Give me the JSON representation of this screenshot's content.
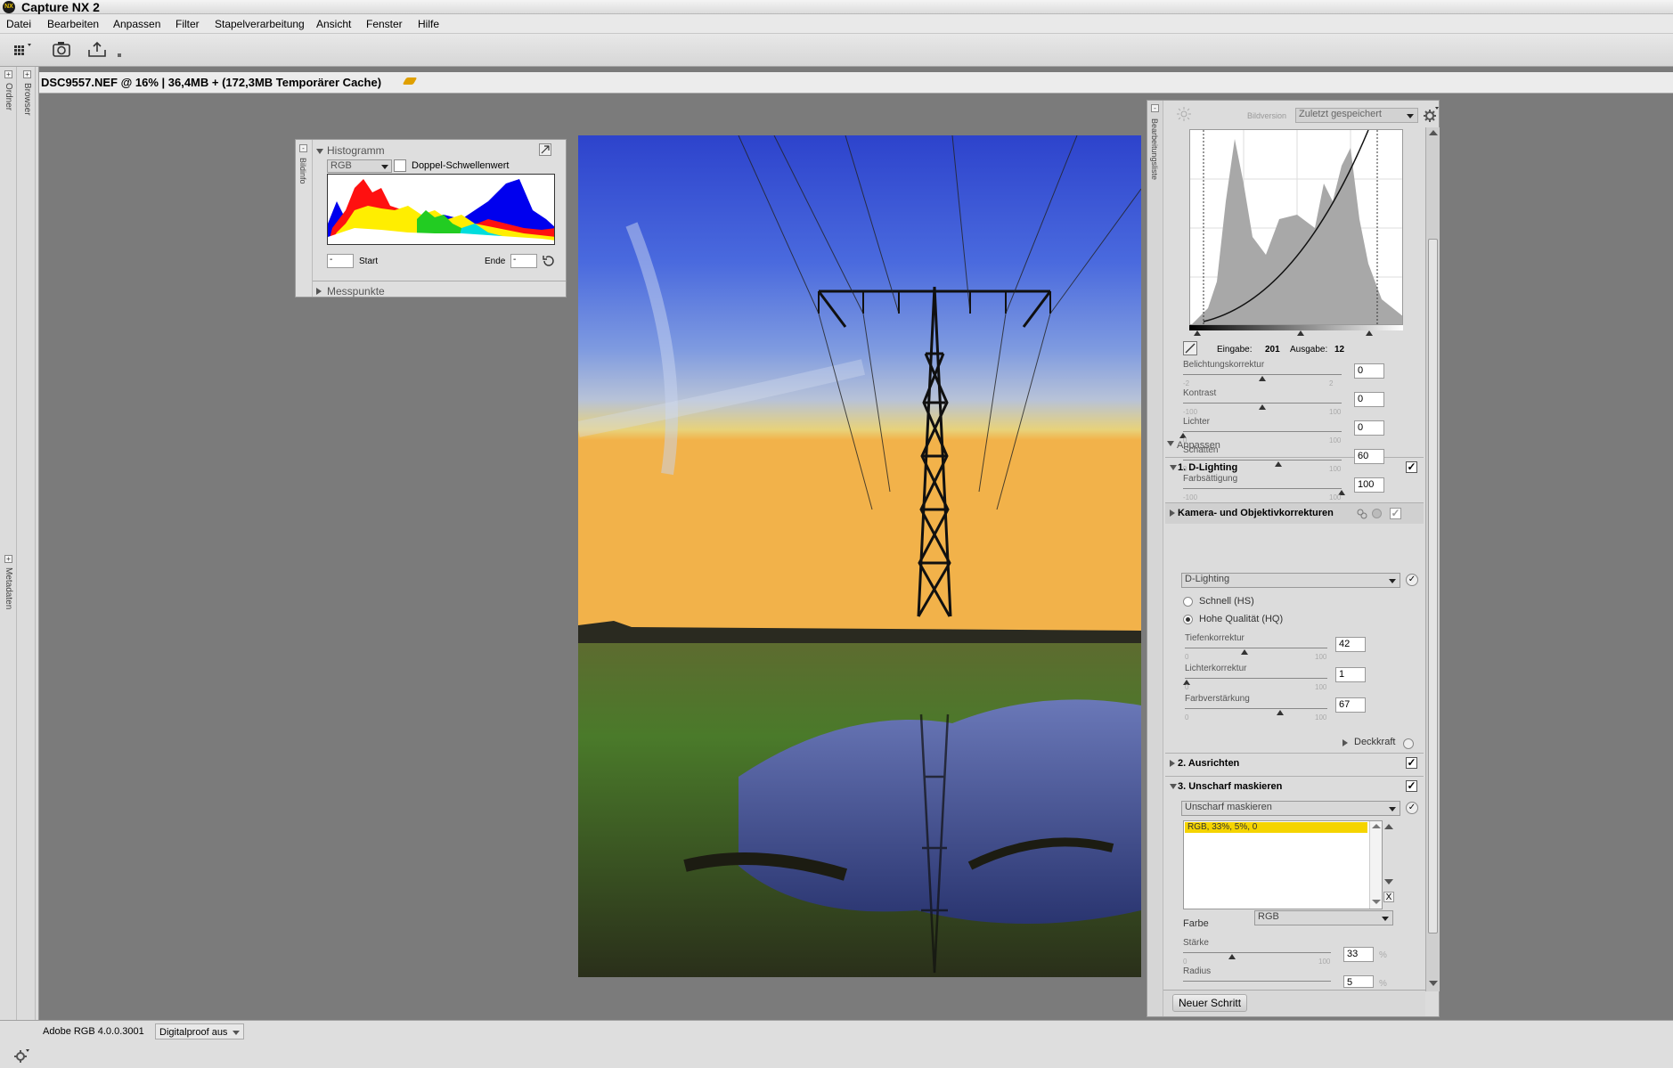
{
  "app": {
    "title": "Capture NX 2",
    "logo_text": "NX"
  },
  "menu": {
    "items": [
      "Datei",
      "Bearbeiten",
      "Anpassen",
      "Filter",
      "Stapelverarbeitung",
      "Ansicht",
      "Fenster",
      "Hilfe"
    ]
  },
  "left_dock": {
    "ordner": "Ordner",
    "browser": "Browser",
    "metadaten": "Metadaten"
  },
  "document": {
    "title": "DSC9557.NEF @ 16% | 36,4MB + (172,3MB Temporärer Cache)"
  },
  "histogram": {
    "title": "Histogramm",
    "side_label": "Bildinfo",
    "channel": "RGB",
    "checkbox_label": "Doppel-Schwellenwert",
    "start_value": "-",
    "start_label": "Start",
    "end_label": "Ende",
    "end_value": "-",
    "messpunkte": "Messpunkte"
  },
  "right_panel": {
    "side_label": "Bearbeitungsliste",
    "bildversion_label": "Bildversion",
    "bildversion_value": "Zuletzt gespeichert",
    "curve": {
      "eingabe_label": "Eingabe:",
      "eingabe_value": "201",
      "ausgabe_label": "Ausgabe:",
      "ausgabe_value": "12"
    },
    "sliders": [
      {
        "label": "Belichtungskorrektur",
        "min": "-2",
        "max": "2",
        "value": "0",
        "level": 0.5
      },
      {
        "label": "Kontrast",
        "min": "-100",
        "max": "100",
        "value": "0",
        "level": 0.5
      },
      {
        "label": "Lichter",
        "min": "0",
        "max": "100",
        "value": "0",
        "level": 0.0
      },
      {
        "label": "Schatten",
        "min": "0",
        "max": "100",
        "value": "60",
        "level": 0.6
      },
      {
        "label": "Farbsättigung",
        "min": "-100",
        "max": "100",
        "value": "100",
        "level": 1.0
      }
    ],
    "camera_section": "Kamera- und Objektivkorrekturen",
    "anpassen_label": "Anpassen",
    "dlighting": {
      "title": "1. D-Lighting",
      "method": "D-Lighting",
      "option_fast": "Schnell (HS)",
      "option_hq": "Hohe Qualität (HQ)",
      "sliders": [
        {
          "label": "Tiefenkorrektur",
          "min": "0",
          "max": "100",
          "value": "42",
          "level": 0.42
        },
        {
          "label": "Lichterkorrektur",
          "min": "0",
          "max": "100",
          "value": "1",
          "level": 0.01
        },
        {
          "label": "Farbverstärkung",
          "min": "0",
          "max": "100",
          "value": "67",
          "level": 0.67
        }
      ],
      "opacity_label": "Deckkraft"
    },
    "ausrichten": {
      "title": "2. Ausrichten"
    },
    "unscharf": {
      "title": "3. Unscharf maskieren",
      "method": "Unscharf maskieren",
      "list_item": "RGB, 33%, 5%, 0",
      "farbe_label": "Farbe",
      "farbe_value": "RGB",
      "staerke_label": "Stärke",
      "staerke_value": "33",
      "staerke_min": "0",
      "staerke_max": "100",
      "staerke_level": 0.33,
      "radius_label": "Radius",
      "radius_value": "5",
      "percent": "%"
    },
    "new_step_button": "Neuer Schritt"
  },
  "status": {
    "color_profile": "Adobe RGB 4.0.0.3001",
    "proof": "Digitalproof aus"
  }
}
